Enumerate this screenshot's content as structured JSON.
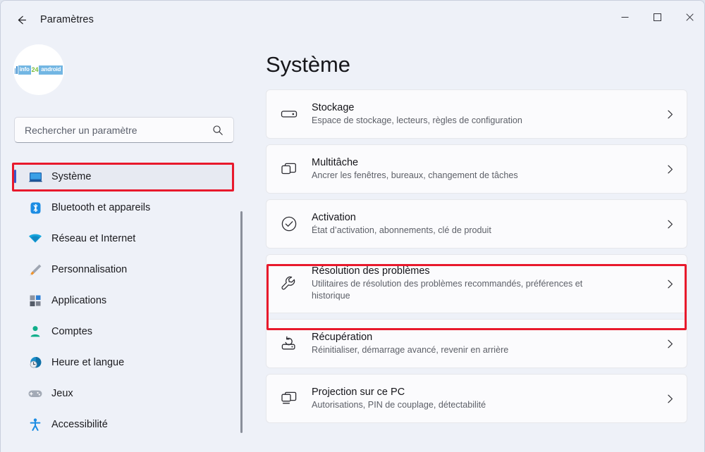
{
  "window": {
    "title": "Paramètres",
    "back_icon": "back-arrow-icon",
    "minimize_label": "Réduire",
    "maximize_label": "Agrandir",
    "close_label": "Fermer"
  },
  "account": {
    "avatar_icon": "user-avatar",
    "logo_text_info": "info",
    "logo_text_numeral": "24",
    "logo_text_android": "android"
  },
  "search": {
    "placeholder": "Rechercher un paramètre",
    "value": "",
    "icon": "search-icon"
  },
  "sidebar": {
    "items": [
      {
        "label": "Système",
        "icon": "monitor-icon",
        "selected": true
      },
      {
        "label": "Bluetooth et appareils",
        "icon": "bluetooth-icon",
        "selected": false
      },
      {
        "label": "Réseau et Internet",
        "icon": "wifi-icon",
        "selected": false
      },
      {
        "label": "Personnalisation",
        "icon": "paintbrush-icon",
        "selected": false
      },
      {
        "label": "Applications",
        "icon": "apps-grid-icon",
        "selected": false
      },
      {
        "label": "Comptes",
        "icon": "person-icon",
        "selected": false
      },
      {
        "label": "Heure et langue",
        "icon": "clock-globe-icon",
        "selected": false
      },
      {
        "label": "Jeux",
        "icon": "gamepad-icon",
        "selected": false
      },
      {
        "label": "Accessibilité",
        "icon": "accessibility-icon",
        "selected": false
      }
    ]
  },
  "main": {
    "page_title": "Système",
    "cards": [
      {
        "title": "Stockage",
        "subtitle": "Espace de stockage, lecteurs, règles de configuration",
        "icon": "hard-drive-icon",
        "chevron": "chevron-right-icon",
        "highlighted": false
      },
      {
        "title": "Multitâche",
        "subtitle": "Ancrer les fenêtres, bureaux, changement de tâches",
        "icon": "multitask-windows-icon",
        "chevron": "chevron-right-icon",
        "highlighted": false
      },
      {
        "title": "Activation",
        "subtitle": "État d’activation, abonnements, clé de produit",
        "icon": "check-circle-icon",
        "chevron": "chevron-right-icon",
        "highlighted": false
      },
      {
        "title": "Résolution des problèmes",
        "subtitle": "Utilitaires de résolution des problèmes recommandés, préférences et historique",
        "icon": "wrench-icon",
        "chevron": "chevron-right-icon",
        "highlighted": true
      },
      {
        "title": "Récupération",
        "subtitle": "Réinitialiser, démarrage avancé, revenir en arrière",
        "icon": "drive-restore-icon",
        "chevron": "chevron-right-icon",
        "highlighted": false
      },
      {
        "title": "Projection sur ce PC",
        "subtitle": "Autorisations, PIN de couplage, détectabilité",
        "icon": "projection-icon",
        "chevron": "chevron-right-icon",
        "highlighted": false
      }
    ]
  },
  "annotations": {
    "highlight_color": "#e8192c",
    "boxes": [
      {
        "target": "sidebar-item-systeme"
      },
      {
        "target": "card-resolution-des-problemes"
      }
    ]
  },
  "scrollbar": {
    "name": "sidebar-scrollbar"
  }
}
